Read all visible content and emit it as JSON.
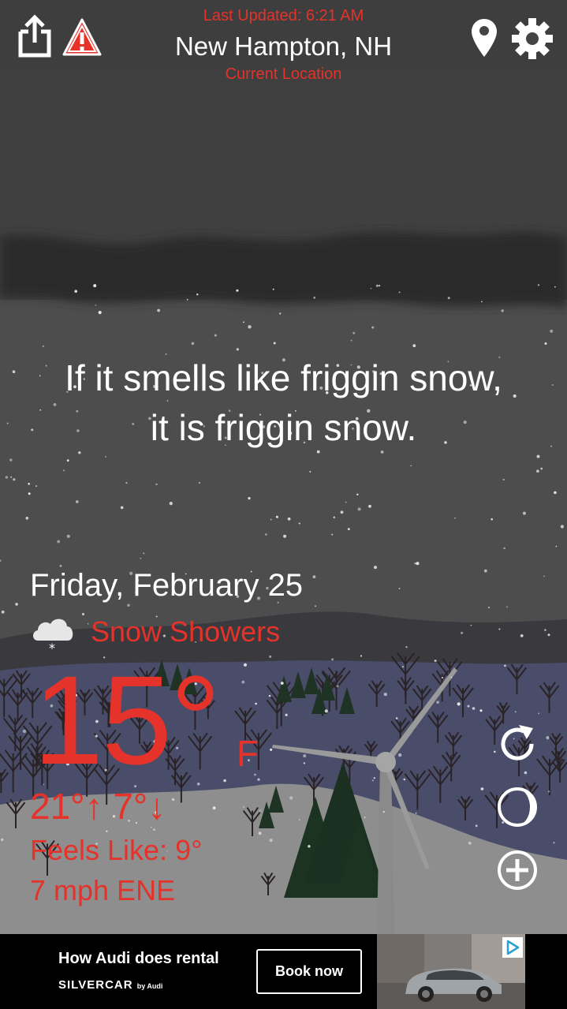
{
  "header": {
    "last_updated": "Last Updated: 6:21 AM",
    "location": "New Hampton, NH",
    "location_source": "Current Location"
  },
  "icons": {
    "share": "share-icon",
    "alert": "warning-icon",
    "location": "map-pin-icon",
    "settings": "gear-icon",
    "refresh": "refresh-icon",
    "moon": "moon-icon",
    "add": "add-circle-icon"
  },
  "quote": {
    "line1": "If it smells like friggin snow,",
    "line2": "it is friggin snow."
  },
  "weather": {
    "date": "Friday, February 25",
    "condition": "Snow Showers",
    "temperature": "15°",
    "unit": "F",
    "high": "21°",
    "low": "7°",
    "feels_like": "Feels Like: 9°",
    "wind": "7 mph ENE"
  },
  "ad": {
    "headline": "How Audi does rental",
    "brand": "SILVERCAR",
    "brand_sub": "by Audi",
    "cta": "Book now"
  },
  "colors": {
    "accent_red": "#e5322a",
    "text_white": "#ffffff",
    "sky": "#4a4a4a",
    "ad_bg": "#000000"
  }
}
